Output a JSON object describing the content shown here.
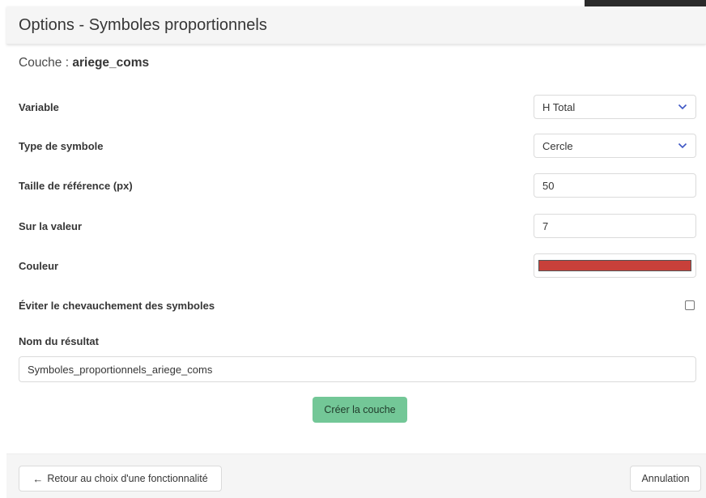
{
  "modal": {
    "title": "Options - Symboles proportionnels"
  },
  "layer": {
    "prefix": "Couche :",
    "name": "ariege_coms"
  },
  "fields": {
    "variable": {
      "label": "Variable",
      "value": "H Total"
    },
    "symbol_type": {
      "label": "Type de symbole",
      "value": "Cercle"
    },
    "reference_size": {
      "label": "Taille de référence (px)",
      "value": "50"
    },
    "on_value": {
      "label": "Sur la valeur",
      "value": "7"
    },
    "color": {
      "label": "Couleur",
      "value": "#c8403a"
    },
    "avoid_overlap": {
      "label": "Éviter le chevauchement des symboles",
      "checked": false
    },
    "result_name": {
      "label": "Nom du résultat",
      "value": "Symboles_proportionnels_ariege_coms"
    }
  },
  "buttons": {
    "create": "Créer la couche",
    "back_arrow": "←",
    "back": "Retour au choix d'une fonctionnalité",
    "cancel": "Annulation"
  },
  "colors": {
    "create_button": "#73c797",
    "chevron": "#3e56c4",
    "header_bg": "#f5f5f5"
  },
  "icons": {
    "select_chevron": "chevron-down-icon",
    "back": "arrow-left-icon"
  }
}
